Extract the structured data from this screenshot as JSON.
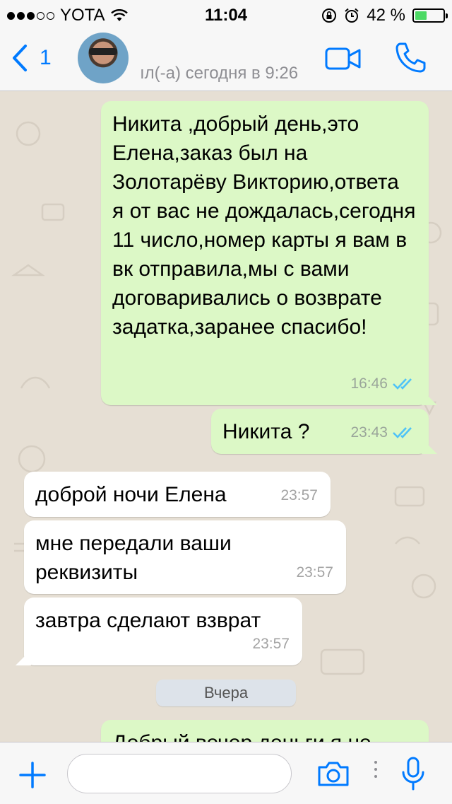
{
  "status_bar": {
    "carrier": "YOTA",
    "time": "11:04",
    "battery_percent": "42 %",
    "battery_level": 0.42
  },
  "header": {
    "back_count": "1",
    "contact_status": "ıл(-а) сегодня в 9:26",
    "icons": [
      "back-chevron-icon",
      "video-call-icon",
      "phone-icon"
    ]
  },
  "messages": [
    {
      "direction": "out",
      "text": "Никита ,добрый день,это Елена,заказ был на Золотарёву Викторию,ответа я от вас не дождалась,сегодня 11 число,номер карты я вам в вк отправила,мы с вами договаривались о возврате задатка,заранее спасибо!",
      "time": "16:46",
      "read": true
    },
    {
      "direction": "out",
      "text": "Никита ?",
      "time": "23:43",
      "read": true
    },
    {
      "direction": "in",
      "text": "доброй ночи Елена",
      "time": "23:57"
    },
    {
      "direction": "in",
      "text": "мне передали ваши реквизиты",
      "time": "23:57"
    },
    {
      "direction": "in",
      "text": "завтра сделают взврат",
      "time": "23:57"
    }
  ],
  "date_separator": "Вчера",
  "partial_message": {
    "direction": "out",
    "text": "Добрый вечер деньги я не"
  },
  "colors": {
    "accent": "#007aff",
    "outgoing_bubble": "#dcf8c6",
    "incoming_bubble": "#ffffff",
    "read_ticks": "#4fc3f7",
    "battery": "#4cd964"
  }
}
